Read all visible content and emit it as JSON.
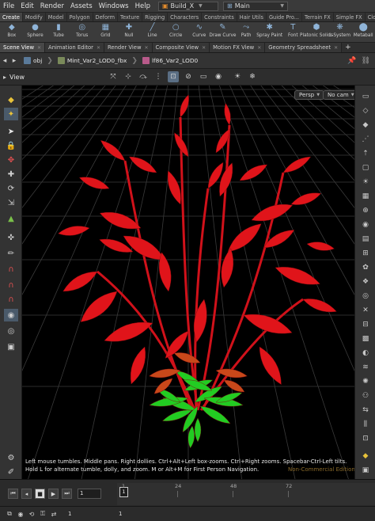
{
  "menu": {
    "items": [
      "File",
      "Edit",
      "Render",
      "Assets",
      "Windows",
      "Help"
    ],
    "desktop": "Build_X",
    "workspace": "Main"
  },
  "shelf_tabs": [
    "Create",
    "Modify",
    "Model",
    "Polygon",
    "Deform",
    "Texture",
    "Rigging",
    "Characters",
    "Constraints",
    "Hair Utils",
    "Guide Pro...",
    "Terrain FX",
    "Simple FX",
    "Cloud FX"
  ],
  "shelf_tools": [
    {
      "label": "Box",
      "icon": "box-icon",
      "glyph": "◆"
    },
    {
      "label": "Sphere",
      "icon": "sphere-icon",
      "glyph": "●"
    },
    {
      "label": "Tube",
      "icon": "tube-icon",
      "glyph": "▮"
    },
    {
      "label": "Torus",
      "icon": "torus-icon",
      "glyph": "◎"
    },
    {
      "label": "Grid",
      "icon": "grid-icon",
      "glyph": "▦"
    },
    {
      "label": "Null",
      "icon": "null-icon",
      "glyph": "✚"
    },
    {
      "label": "Line",
      "icon": "line-icon",
      "glyph": "╱"
    },
    {
      "label": "Circle",
      "icon": "circle-icon",
      "glyph": "○"
    },
    {
      "label": "Curve",
      "icon": "curve-icon",
      "glyph": "∿"
    },
    {
      "label": "Draw Curve",
      "icon": "draw-curve-icon",
      "glyph": "✎"
    },
    {
      "label": "Path",
      "icon": "path-icon",
      "glyph": "⤳"
    },
    {
      "label": "Spray Paint",
      "icon": "spray-paint-icon",
      "glyph": "✱"
    },
    {
      "label": "Font",
      "icon": "font-icon",
      "glyph": "T"
    },
    {
      "label": "Platonic Solids",
      "icon": "platonic-solids-icon",
      "glyph": "⬢"
    },
    {
      "label": "L-System",
      "icon": "l-system-icon",
      "glyph": "❋"
    },
    {
      "label": "Metaball",
      "icon": "metaball-icon",
      "glyph": "⬤"
    }
  ],
  "pane_tabs": [
    "Scene View",
    "Animation Editor",
    "Render View",
    "Composite View",
    "Motion FX View",
    "Geometry Spreadsheet"
  ],
  "path": {
    "root": "obj",
    "node1": "Mint_Var2_LOD0_fbx",
    "node2": "lf86_Var2_LOD0"
  },
  "viewer": {
    "title": "View",
    "persp": "Persp",
    "camera": "No cam"
  },
  "hint_text": "Left mouse tumbles. Middle pans. Right dollies. Ctrl+Alt+Left box-zooms. Ctrl+Right zooms. Spacebar-Ctrl-Left tilts. Hold L for alternate tumble, dolly, and zoom.    M or Alt+M for First Person Navigation.",
  "edition_text": "Non-Commercial Edition",
  "timeline": {
    "current_frame": "1",
    "ruler_marks": [
      "1",
      "24",
      "48",
      "72"
    ],
    "ruler_cursor": "1"
  },
  "bottom": {
    "start": "1",
    "end": "1"
  },
  "colors": {
    "leaf_red": "#e0141a",
    "leaf_orange": "#c8481a",
    "leaf_green": "#22cc22",
    "accent": "#e08a2c"
  }
}
